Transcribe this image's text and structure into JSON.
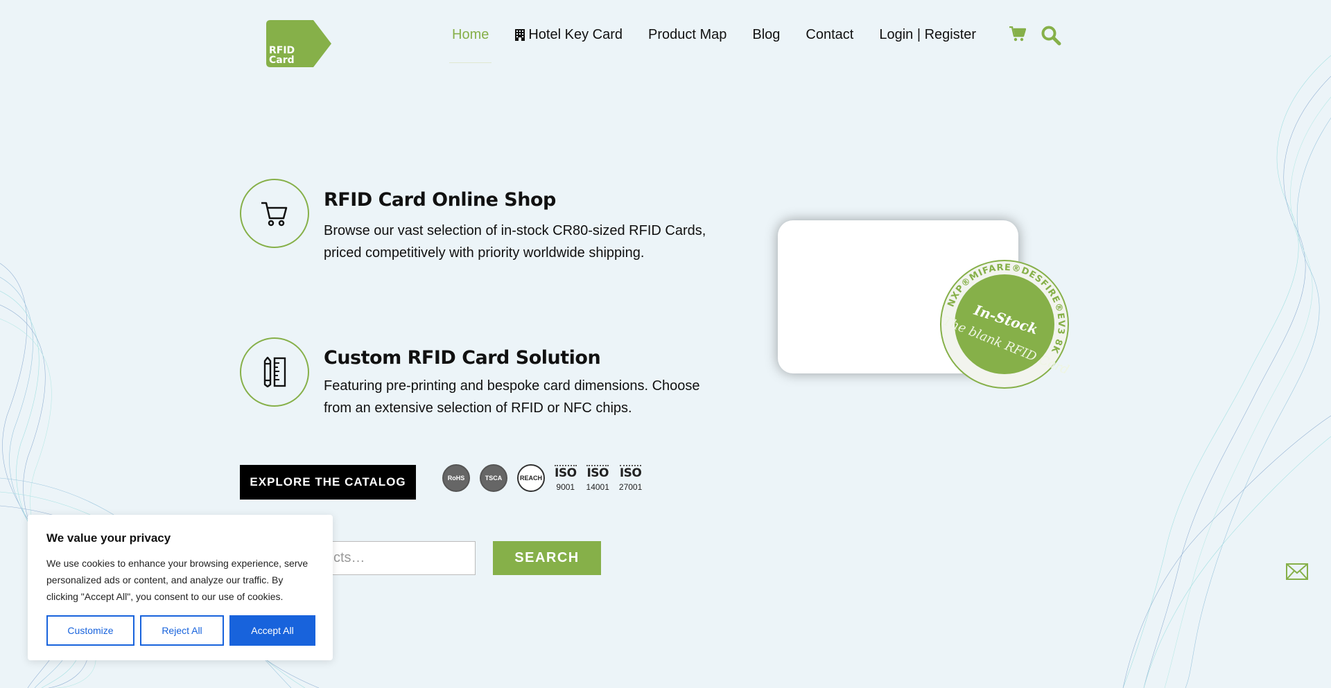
{
  "brand": {
    "logo_text_line1": "RFID",
    "logo_text_line2": "Card",
    "accent_color": "#86b049"
  },
  "nav": {
    "items": [
      {
        "label": "Home",
        "active": true
      },
      {
        "label": "Hotel Key Card",
        "icon": "building-icon"
      },
      {
        "label": "Product Map"
      },
      {
        "label": "Blog"
      },
      {
        "label": "Contact"
      },
      {
        "label": "Login | Register"
      }
    ],
    "cart_icon": "cart-icon",
    "search_icon": "search-icon"
  },
  "features": [
    {
      "icon": "shopping-cart-icon",
      "title": "RFID Card Online Shop",
      "description": "Browse our vast selection of in-stock CR80-sized RFID Cards, priced competitively with priority worldwide shipping."
    },
    {
      "icon": "pencil-ruler-icon",
      "title": "Custom RFID Card Solution",
      "description": "Featuring pre-printing and bespoke card dimensions. Choose from an extensive selection of RFID or NFC chips."
    }
  ],
  "cta": {
    "explore_label": "EXPLORE THE CATALOG"
  },
  "certifications": {
    "round": [
      "RoHS",
      "TSCA",
      "REACH"
    ],
    "iso": [
      {
        "label": "ISO",
        "number": "9001"
      },
      {
        "label": "ISO",
        "number": "14001"
      },
      {
        "label": "ISO",
        "number": "27001"
      }
    ]
  },
  "product_search": {
    "placeholder_visible": "cts…",
    "button_label": "SEARCH"
  },
  "stamp": {
    "ring_text": "NXP®MIFARE®DESFIRE®EV3 8K",
    "center_text": "In-Stock",
    "script_text": "The blank RFID Card"
  },
  "cookie_banner": {
    "title": "We value your privacy",
    "body": "We use cookies to enhance your browsing experience, serve personalized ads or content, and analyze our traffic. By clicking \"Accept All\", you consent to our use of cookies.",
    "customize_label": "Customize",
    "reject_label": "Reject All",
    "accept_label": "Accept All",
    "button_color": "#1863dc"
  }
}
